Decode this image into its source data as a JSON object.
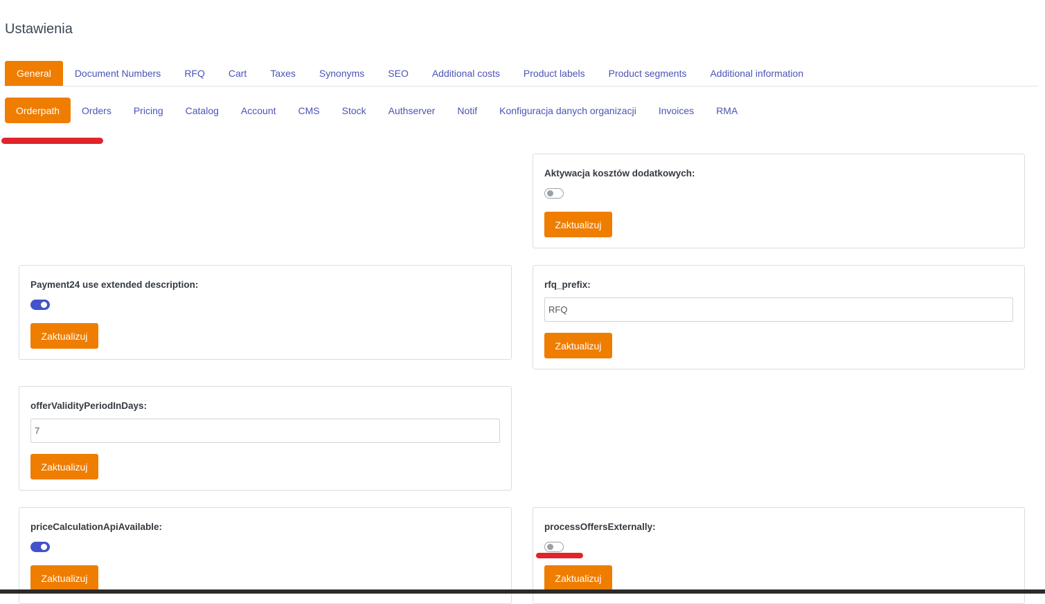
{
  "page": {
    "title": "Ustawienia"
  },
  "tabs_primary": [
    {
      "label": "General",
      "active": true
    },
    {
      "label": "Document Numbers"
    },
    {
      "label": "RFQ"
    },
    {
      "label": "Cart"
    },
    {
      "label": "Taxes"
    },
    {
      "label": "Synonyms"
    },
    {
      "label": "SEO"
    },
    {
      "label": "Additional costs"
    },
    {
      "label": "Product labels"
    },
    {
      "label": "Product segments"
    },
    {
      "label": "Additional information"
    }
  ],
  "tabs_secondary": [
    {
      "label": "Orderpath",
      "active": true
    },
    {
      "label": "Orders"
    },
    {
      "label": "Pricing"
    },
    {
      "label": "Catalog"
    },
    {
      "label": "Account"
    },
    {
      "label": "CMS"
    },
    {
      "label": "Stock"
    },
    {
      "label": "Authserver"
    },
    {
      "label": "Notif"
    },
    {
      "label": "Konfiguracja danych organizacji"
    },
    {
      "label": "Invoices"
    },
    {
      "label": "RMA"
    }
  ],
  "settings": {
    "additional_costs_activation": {
      "label": "Aktywacja kosztów dodatkowych:",
      "enabled": false,
      "button": "Zaktualizuj"
    },
    "payment24_extended": {
      "label": "Payment24 use extended description:",
      "enabled": true,
      "button": "Zaktualizuj"
    },
    "rfq_prefix": {
      "label": "rfq_prefix:",
      "value": "RFQ",
      "button": "Zaktualizuj"
    },
    "offer_validity": {
      "label": "offerValidityPeriodInDays:",
      "value": "7",
      "button": "Zaktualizuj"
    },
    "price_calc_api": {
      "label": "priceCalculationApiAvailable:",
      "enabled": true,
      "button": "Zaktualizuj"
    },
    "process_offers_externally": {
      "label": "processOffersExternally:",
      "enabled": false,
      "button": "Zaktualizuj"
    }
  },
  "colors": {
    "accent": "#ef7d00",
    "link": "#4b53b5",
    "toggle_on": "#4353c9",
    "annotation": "#e0242b"
  }
}
